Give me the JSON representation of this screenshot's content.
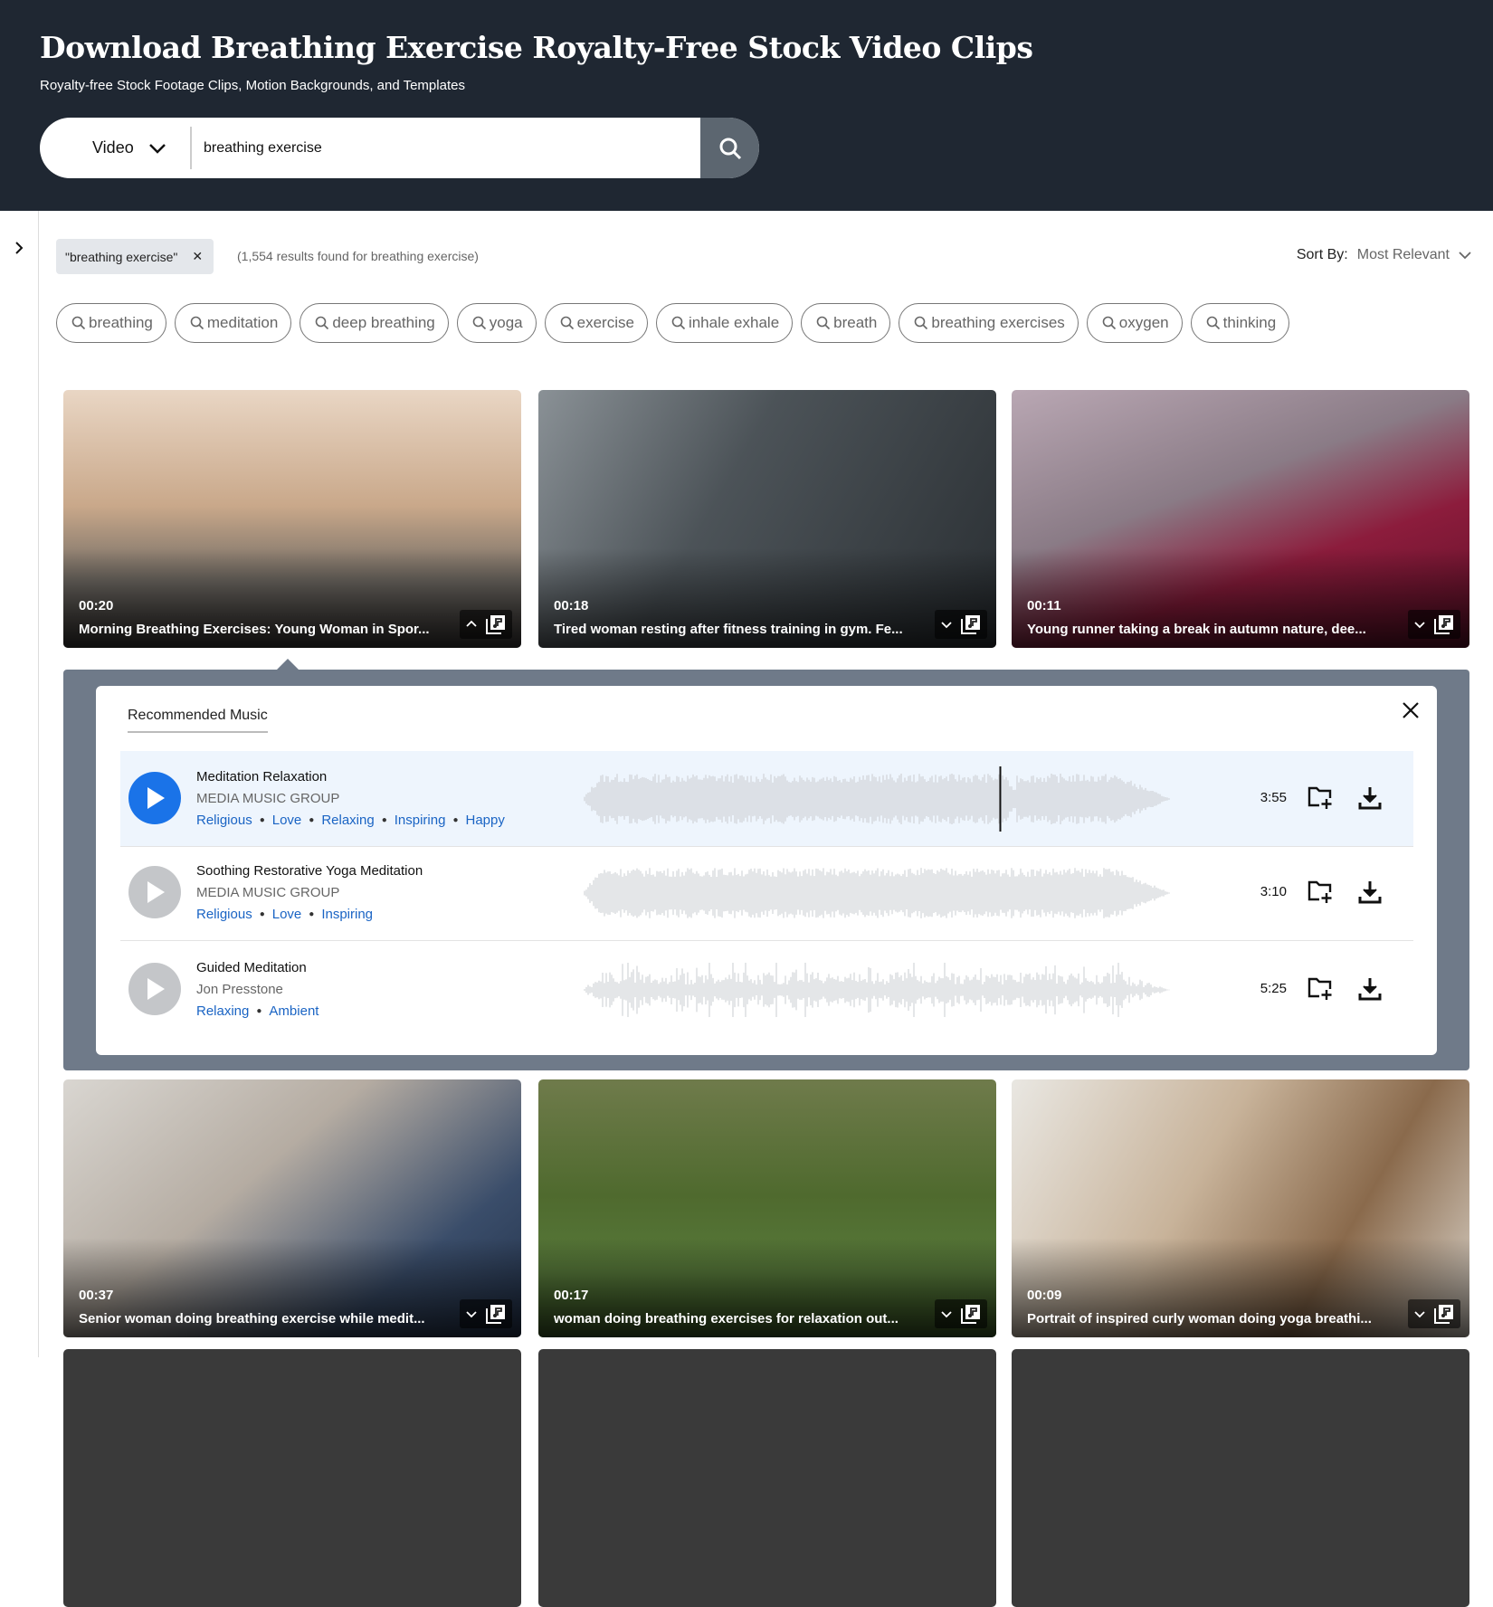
{
  "header": {
    "title": "Download Breathing Exercise Royalty-Free Stock Video Clips",
    "subtitle": "Royalty-free Stock Footage Clips, Motion Backgrounds, and Templates",
    "search": {
      "type": "Video",
      "query": "breathing exercise",
      "icon": "search-icon"
    }
  },
  "filters": {
    "chip": "\"breathing exercise\"",
    "results": "(1,554 results found for breathing exercise)",
    "sort_label": "Sort By:",
    "sort_value": "Most Relevant"
  },
  "tags": [
    "breathing",
    "meditation",
    "deep breathing",
    "yoga",
    "exercise",
    "inhale exhale",
    "breath",
    "breathing exercises",
    "oxygen",
    "thinking"
  ],
  "videos": [
    {
      "duration": "00:20",
      "title": "Morning Breathing Exercises: Young Woman in Spor...",
      "expanded": true,
      "bg": "linear-gradient(180deg,#e9d6c4 0%,#c9a88a 45%,#6f6a64 75%,#3d3a38 100%)"
    },
    {
      "duration": "00:18",
      "title": "Tired woman resting after fitness training in gym. Fe...",
      "expanded": false,
      "bg": "linear-gradient(120deg,#8a9196 0%,#4c5358 40%,#2a2f33 100%)"
    },
    {
      "duration": "00:11",
      "title": "Young runner taking a break in autumn nature, dee...",
      "expanded": false,
      "bg": "linear-gradient(160deg,#b9a7b3 0%,#8a7b86 40%,#8c1c3c 65%,#5e1028 100%)"
    },
    {
      "duration": "00:37",
      "title": "Senior woman doing breathing exercise while medit...",
      "expanded": false,
      "bg": "linear-gradient(140deg,#d9d6d1 0%,#b5aca2 40%,#3a4d6a 75%,#23324a 100%)"
    },
    {
      "duration": "00:17",
      "title": "woman doing breathing exercises for relaxation out...",
      "expanded": false,
      "bg": "linear-gradient(180deg,#6f7b4b 0%,#4f6a2e 45%,#57793a 75%,#3c5a26 100%)"
    },
    {
      "duration": "00:09",
      "title": "Portrait of inspired curly woman doing yoga breathi...",
      "expanded": false,
      "bg": "linear-gradient(120deg,#e9e7e2 0%,#c8b39a 40%,#8a6a4c 70%,#d9d2c8 100%)"
    }
  ],
  "music": {
    "tab": "Recommended Music",
    "tracks": [
      {
        "title": "Meditation Relaxation",
        "artist": "MEDIA MUSIC GROUP",
        "tags": [
          "Religious",
          "Love",
          "Relaxing",
          "Inspiring",
          "Happy"
        ],
        "duration": "3:55",
        "active": true,
        "progress": 0.71
      },
      {
        "title": "Soothing Restorative Yoga Meditation",
        "artist": "MEDIA MUSIC GROUP",
        "tags": [
          "Religious",
          "Love",
          "Inspiring"
        ],
        "duration": "3:10",
        "active": false
      },
      {
        "title": "Guided Meditation",
        "artist": "Jon Presstone",
        "tags": [
          "Relaxing",
          "Ambient"
        ],
        "duration": "5:25",
        "active": false
      }
    ]
  },
  "colors": {
    "header": "#1f2732",
    "accent": "#1a73e8",
    "link": "#1a64c4",
    "panel": "#6f7a89"
  }
}
